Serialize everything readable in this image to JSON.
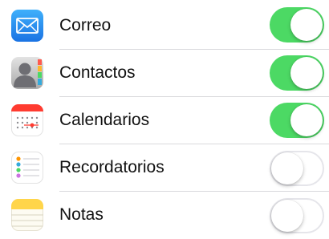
{
  "settings": {
    "items": [
      {
        "label": "Correo",
        "icon": "mail-icon",
        "enabled": true
      },
      {
        "label": "Contactos",
        "icon": "contacts-icon",
        "enabled": true
      },
      {
        "label": "Calendarios",
        "icon": "calendar-icon",
        "enabled": true
      },
      {
        "label": "Recordatorios",
        "icon": "reminders-icon",
        "enabled": false
      },
      {
        "label": "Notas",
        "icon": "notes-icon",
        "enabled": false
      }
    ]
  },
  "colors": {
    "toggle_on": "#4cd964",
    "toggle_off_border": "#e5e5ea",
    "mail_icon": "#2a8cf0",
    "calendar_accent": "#ff3b30",
    "notes_icon": "#ffd54a"
  }
}
